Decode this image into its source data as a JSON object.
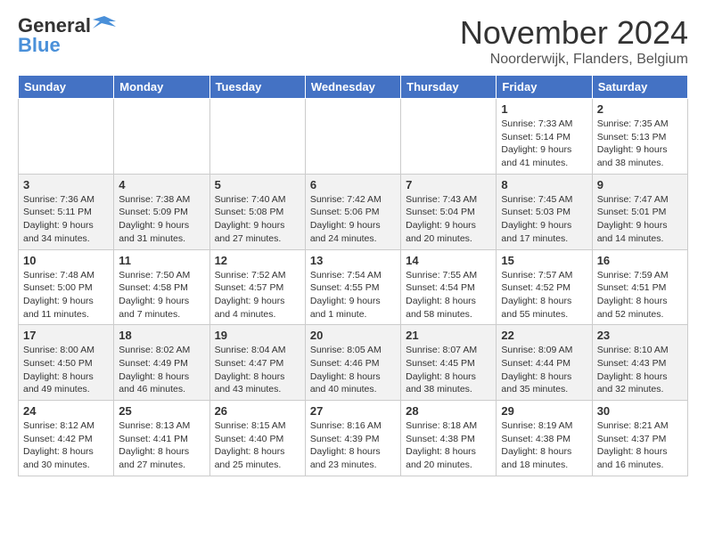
{
  "header": {
    "logo_line1": "General",
    "logo_line2": "Blue",
    "main_title": "November 2024",
    "subtitle": "Noorderwijk, Flanders, Belgium"
  },
  "calendar": {
    "days_of_week": [
      "Sunday",
      "Monday",
      "Tuesday",
      "Wednesday",
      "Thursday",
      "Friday",
      "Saturday"
    ],
    "weeks": [
      [
        {
          "day": "",
          "info": ""
        },
        {
          "day": "",
          "info": ""
        },
        {
          "day": "",
          "info": ""
        },
        {
          "day": "",
          "info": ""
        },
        {
          "day": "",
          "info": ""
        },
        {
          "day": "1",
          "info": "Sunrise: 7:33 AM\nSunset: 5:14 PM\nDaylight: 9 hours\nand 41 minutes."
        },
        {
          "day": "2",
          "info": "Sunrise: 7:35 AM\nSunset: 5:13 PM\nDaylight: 9 hours\nand 38 minutes."
        }
      ],
      [
        {
          "day": "3",
          "info": "Sunrise: 7:36 AM\nSunset: 5:11 PM\nDaylight: 9 hours\nand 34 minutes."
        },
        {
          "day": "4",
          "info": "Sunrise: 7:38 AM\nSunset: 5:09 PM\nDaylight: 9 hours\nand 31 minutes."
        },
        {
          "day": "5",
          "info": "Sunrise: 7:40 AM\nSunset: 5:08 PM\nDaylight: 9 hours\nand 27 minutes."
        },
        {
          "day": "6",
          "info": "Sunrise: 7:42 AM\nSunset: 5:06 PM\nDaylight: 9 hours\nand 24 minutes."
        },
        {
          "day": "7",
          "info": "Sunrise: 7:43 AM\nSunset: 5:04 PM\nDaylight: 9 hours\nand 20 minutes."
        },
        {
          "day": "8",
          "info": "Sunrise: 7:45 AM\nSunset: 5:03 PM\nDaylight: 9 hours\nand 17 minutes."
        },
        {
          "day": "9",
          "info": "Sunrise: 7:47 AM\nSunset: 5:01 PM\nDaylight: 9 hours\nand 14 minutes."
        }
      ],
      [
        {
          "day": "10",
          "info": "Sunrise: 7:48 AM\nSunset: 5:00 PM\nDaylight: 9 hours\nand 11 minutes."
        },
        {
          "day": "11",
          "info": "Sunrise: 7:50 AM\nSunset: 4:58 PM\nDaylight: 9 hours\nand 7 minutes."
        },
        {
          "day": "12",
          "info": "Sunrise: 7:52 AM\nSunset: 4:57 PM\nDaylight: 9 hours\nand 4 minutes."
        },
        {
          "day": "13",
          "info": "Sunrise: 7:54 AM\nSunset: 4:55 PM\nDaylight: 9 hours\nand 1 minute."
        },
        {
          "day": "14",
          "info": "Sunrise: 7:55 AM\nSunset: 4:54 PM\nDaylight: 8 hours\nand 58 minutes."
        },
        {
          "day": "15",
          "info": "Sunrise: 7:57 AM\nSunset: 4:52 PM\nDaylight: 8 hours\nand 55 minutes."
        },
        {
          "day": "16",
          "info": "Sunrise: 7:59 AM\nSunset: 4:51 PM\nDaylight: 8 hours\nand 52 minutes."
        }
      ],
      [
        {
          "day": "17",
          "info": "Sunrise: 8:00 AM\nSunset: 4:50 PM\nDaylight: 8 hours\nand 49 minutes."
        },
        {
          "day": "18",
          "info": "Sunrise: 8:02 AM\nSunset: 4:49 PM\nDaylight: 8 hours\nand 46 minutes."
        },
        {
          "day": "19",
          "info": "Sunrise: 8:04 AM\nSunset: 4:47 PM\nDaylight: 8 hours\nand 43 minutes."
        },
        {
          "day": "20",
          "info": "Sunrise: 8:05 AM\nSunset: 4:46 PM\nDaylight: 8 hours\nand 40 minutes."
        },
        {
          "day": "21",
          "info": "Sunrise: 8:07 AM\nSunset: 4:45 PM\nDaylight: 8 hours\nand 38 minutes."
        },
        {
          "day": "22",
          "info": "Sunrise: 8:09 AM\nSunset: 4:44 PM\nDaylight: 8 hours\nand 35 minutes."
        },
        {
          "day": "23",
          "info": "Sunrise: 8:10 AM\nSunset: 4:43 PM\nDaylight: 8 hours\nand 32 minutes."
        }
      ],
      [
        {
          "day": "24",
          "info": "Sunrise: 8:12 AM\nSunset: 4:42 PM\nDaylight: 8 hours\nand 30 minutes."
        },
        {
          "day": "25",
          "info": "Sunrise: 8:13 AM\nSunset: 4:41 PM\nDaylight: 8 hours\nand 27 minutes."
        },
        {
          "day": "26",
          "info": "Sunrise: 8:15 AM\nSunset: 4:40 PM\nDaylight: 8 hours\nand 25 minutes."
        },
        {
          "day": "27",
          "info": "Sunrise: 8:16 AM\nSunset: 4:39 PM\nDaylight: 8 hours\nand 23 minutes."
        },
        {
          "day": "28",
          "info": "Sunrise: 8:18 AM\nSunset: 4:38 PM\nDaylight: 8 hours\nand 20 minutes."
        },
        {
          "day": "29",
          "info": "Sunrise: 8:19 AM\nSunset: 4:38 PM\nDaylight: 8 hours\nand 18 minutes."
        },
        {
          "day": "30",
          "info": "Sunrise: 8:21 AM\nSunset: 4:37 PM\nDaylight: 8 hours\nand 16 minutes."
        }
      ]
    ]
  }
}
